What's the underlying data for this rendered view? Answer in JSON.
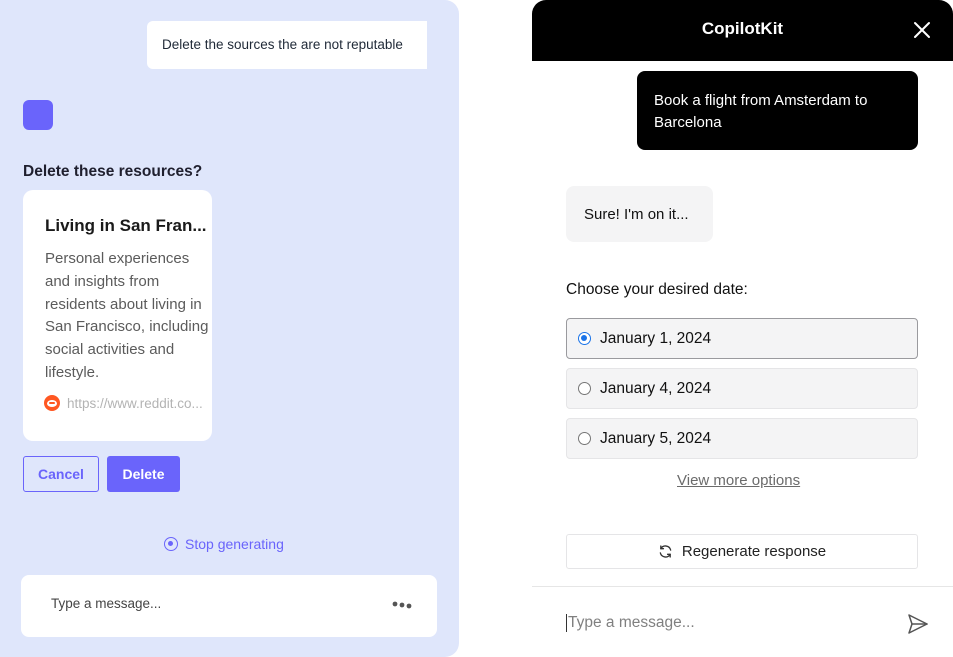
{
  "left_panel": {
    "user_message": "Delete the sources the are not reputable",
    "confirm_heading": "Delete these resources?",
    "resource": {
      "title": "Living in San Fran...",
      "description": "Personal experiences and insights from residents about living in San Francisco, including social activities and lifestyle.",
      "source_url": "https://www.reddit.co...",
      "source_icon": "reddit-icon"
    },
    "cancel_label": "Cancel",
    "delete_label": "Delete",
    "stop_label": "Stop generating",
    "input_placeholder": "Type a message...",
    "accent_color": "#6a64fb",
    "background_color": "#dfe6fb"
  },
  "right_panel": {
    "title": "CopilotKit",
    "user_message": "Book a flight from Amsterdam to Barcelona",
    "assistant_message": "Sure! I'm on it...",
    "date_prompt": "Choose your desired date:",
    "date_options": [
      {
        "label": "January 1, 2024",
        "selected": true
      },
      {
        "label": "January 4, 2024",
        "selected": false
      },
      {
        "label": "January 5, 2024",
        "selected": false
      }
    ],
    "view_more_label": "View more options",
    "regenerate_label": "Regenerate response",
    "input_placeholder": "Type a message..."
  }
}
